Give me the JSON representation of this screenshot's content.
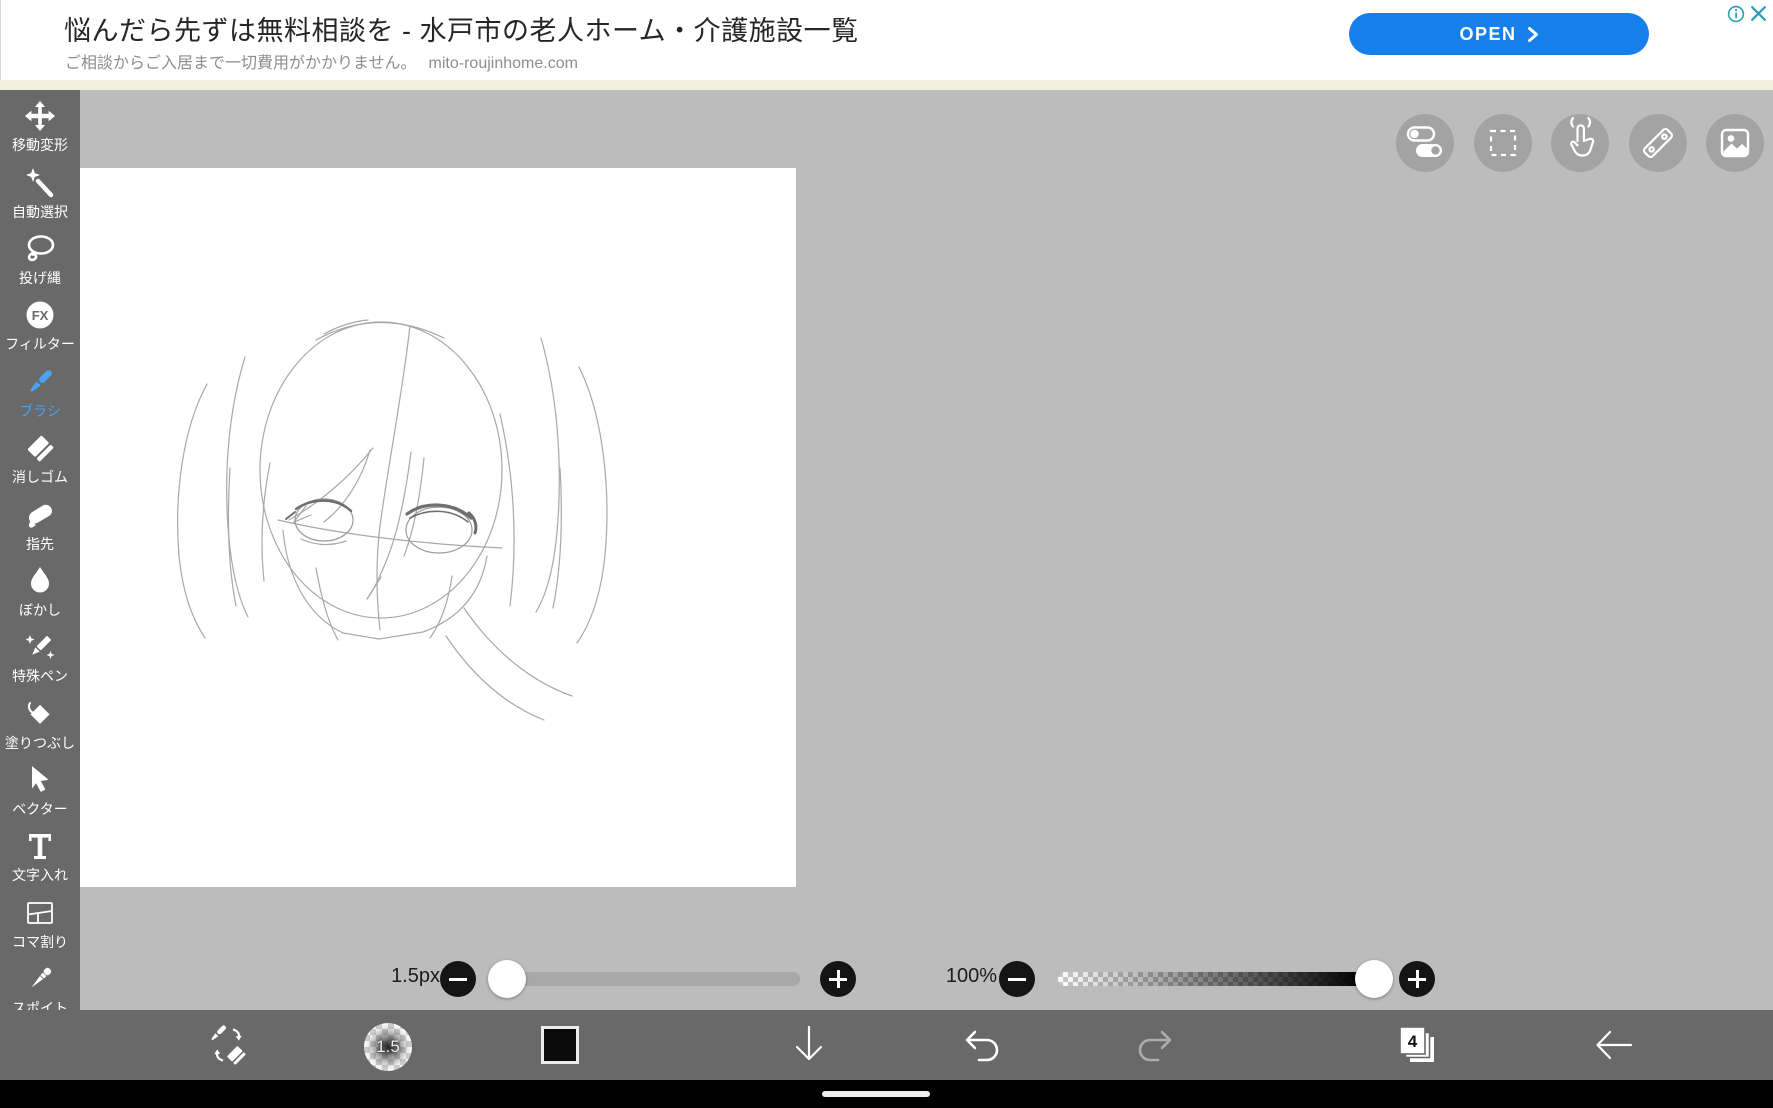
{
  "ad": {
    "headline": "悩んだら先ずは無料相談を - 水戸市の老人ホーム・介護施設一覧",
    "subtitle": "ご相談からご入居まで一切費用がかかりません。",
    "domain": "mito-roujinhome.com",
    "open_label": "OPEN",
    "button_color": "#1580ec",
    "icon_color": "#2aa0b5"
  },
  "sidebar": {
    "filter_icon_text": "FX",
    "selected_tool": "ブラシ",
    "selected_color": "#4aa3f0",
    "tools": [
      {
        "id": "move-transform",
        "label": "移動変形"
      },
      {
        "id": "auto-select",
        "label": "自動選択"
      },
      {
        "id": "lasso",
        "label": "投げ縄"
      },
      {
        "id": "filter",
        "label": "フィルター"
      },
      {
        "id": "brush",
        "label": "ブラシ",
        "selected": true
      },
      {
        "id": "eraser",
        "label": "消しゴム"
      },
      {
        "id": "finger",
        "label": "指先"
      },
      {
        "id": "blur",
        "label": "ぼかし"
      },
      {
        "id": "special-pen",
        "label": "特殊ペン"
      },
      {
        "id": "fill",
        "label": "塗りつぶし"
      },
      {
        "id": "vector",
        "label": "ベクター"
      },
      {
        "id": "text",
        "label": "文字入れ"
      },
      {
        "id": "frame-divider",
        "label": "コマ割り"
      },
      {
        "id": "eyedropper",
        "label": "スポイト"
      }
    ]
  },
  "view_buttons": [
    "quick-settings",
    "selection",
    "touch-gesture",
    "ruler",
    "reference-image"
  ],
  "controls": {
    "brush_size": {
      "label": "1.5px",
      "value": 1.5,
      "knob_percent": 5
    },
    "opacity": {
      "label": "100%",
      "value": 100,
      "knob_percent": 100
    }
  },
  "toolbar": {
    "brush_preview_value": "1.5",
    "layer_count": "4"
  },
  "colors": {
    "panel": "#696969",
    "canvas_background": "#bcbcbc",
    "paper": "#ffffff",
    "accent_blue": "#4aa3f0",
    "ad_strip": "#f0efe0"
  }
}
